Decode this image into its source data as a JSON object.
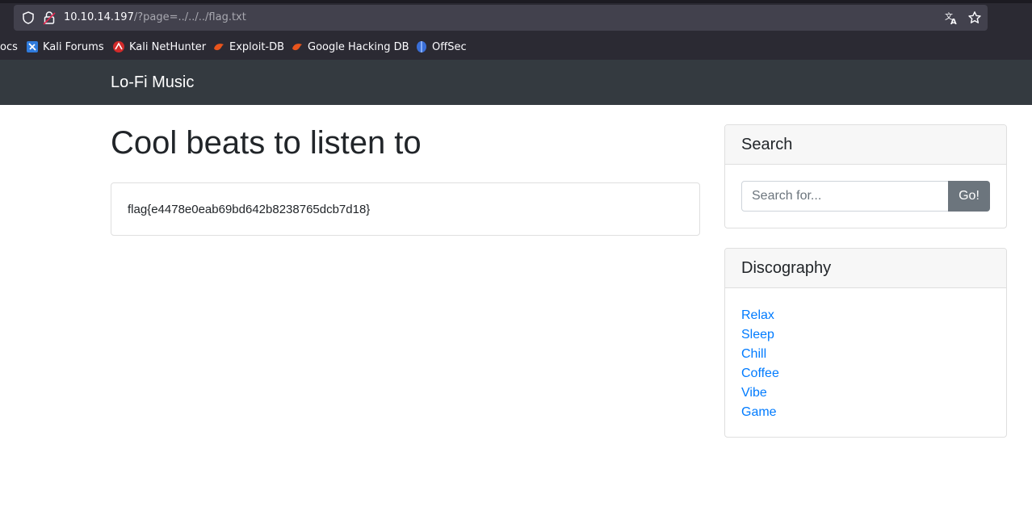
{
  "browser": {
    "url_host": "10.10.14.197",
    "url_path": "/?page=../../../flag.txt",
    "bookmarks": [
      "ocs",
      "Kali Forums",
      "Kali NetHunter",
      "Exploit-DB",
      "Google Hacking DB",
      "OffSec"
    ]
  },
  "navbar": {
    "brand": "Lo-Fi Music"
  },
  "main": {
    "title": "Cool beats to listen to",
    "content": "flag{e4478e0eab69bd642b8238765dcb7d18}"
  },
  "sidebar": {
    "search": {
      "header": "Search",
      "placeholder": "Search for...",
      "button": "Go!"
    },
    "discography": {
      "header": "Discography",
      "items": [
        "Relax",
        "Sleep",
        "Chill",
        "Coffee",
        "Vibe",
        "Game"
      ]
    }
  },
  "colors": {
    "navbar_bg": "#343a40",
    "link": "#007bff",
    "button_bg": "#6c757d"
  }
}
